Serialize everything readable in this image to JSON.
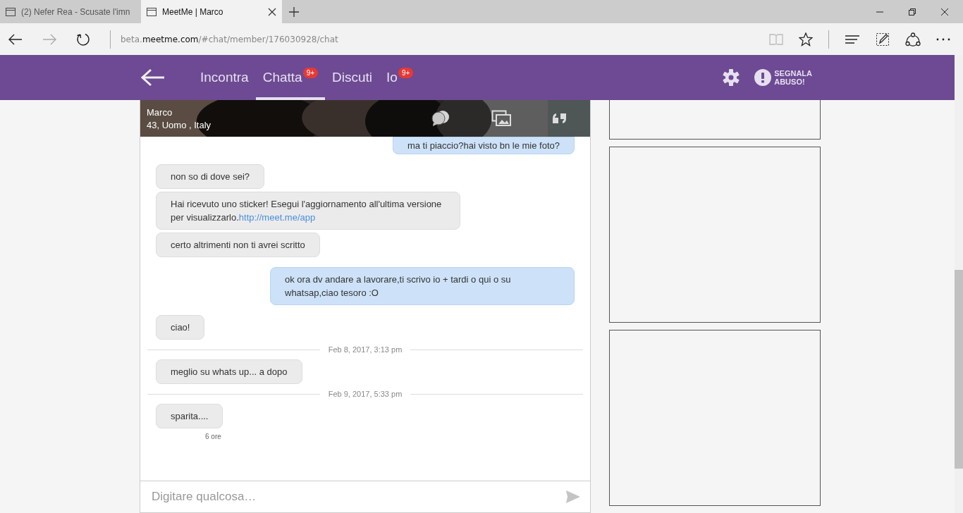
{
  "browser": {
    "tabs": [
      {
        "title": "(2) Nefer Rea - Scusate l'imn",
        "selected": false,
        "closable": false
      },
      {
        "title": "MeetMe | Marco",
        "selected": true,
        "closable": true
      }
    ],
    "address": {
      "prefix": "beta.",
      "domain": "meetme.com",
      "path": "/#chat/member/176030928/chat"
    }
  },
  "nav": {
    "tabs": [
      {
        "label": "Incontra",
        "selected": false
      },
      {
        "label": "Chatta",
        "selected": true,
        "badge": "9+"
      },
      {
        "label": "Discuti",
        "selected": false
      },
      {
        "label": "Io",
        "selected": false,
        "badge": "9+"
      }
    ],
    "report": [
      "SEGNALA",
      "ABUSO!"
    ]
  },
  "profile": {
    "name": "Marco",
    "details": "43, Uomo , Italy"
  },
  "messages": [
    {
      "kind": "sent",
      "text": "ma ti piaccio?hai visto bn le mie foto?"
    },
    {
      "kind": "received",
      "text": "non so di dove sei?"
    },
    {
      "kind": "received",
      "text": "Hai ricevuto uno sticker! Esegui l'aggiornamento all'ultima versione per visualizzarlo.",
      "link": "http://meet.me/app"
    },
    {
      "kind": "received",
      "text": "certo altrimenti non ti avrei scritto"
    },
    {
      "kind": "sent",
      "text": "ok ora dv andare a lavorare,ti scrivo io + tardi o qui o su whatsap,ciao tesoro :O"
    },
    {
      "kind": "received",
      "text": "ciao!"
    },
    {
      "kind": "date",
      "text": "Feb 8, 2017, 3:13 pm"
    },
    {
      "kind": "received",
      "text": "meglio su whats up... a dopo"
    },
    {
      "kind": "date",
      "text": "Feb 9, 2017, 5:33 pm"
    },
    {
      "kind": "received",
      "text": "sparita....",
      "time": "6 ore"
    }
  ],
  "composer": {
    "placeholder": "Digitare qualcosa…"
  }
}
